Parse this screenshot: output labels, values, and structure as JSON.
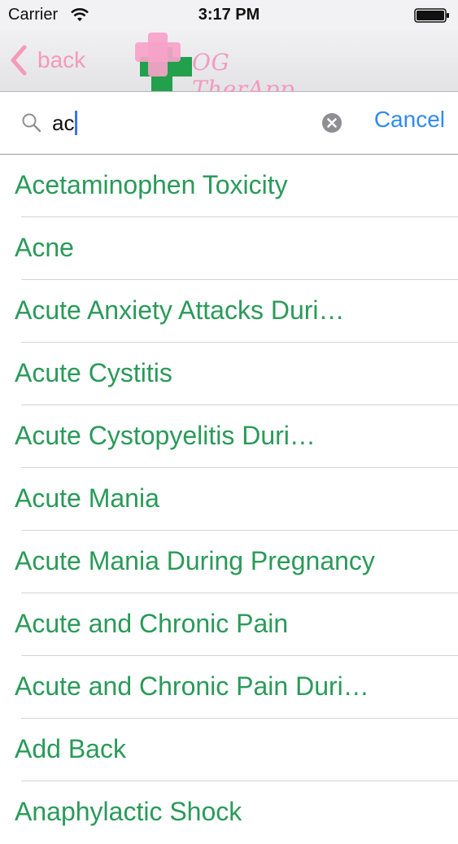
{
  "status": {
    "carrier": "Carrier",
    "time": "3:17 PM"
  },
  "nav": {
    "back_label": "back",
    "app_title": "OG TherApp"
  },
  "search": {
    "query": "ac",
    "cancel_label": "Cancel"
  },
  "results": [
    "Acetaminophen Toxicity",
    "Acne",
    "Acute Anxiety Attacks Duri…",
    "Acute Cystitis",
    "Acute Cystopyelitis Duri…",
    "Acute Mania",
    "Acute Mania During Pregnancy",
    "Acute and Chronic Pain",
    "Acute and Chronic Pain Duri…",
    "Add Back",
    "Anaphylactic Shock"
  ],
  "colors": {
    "accent_pink": "#f59ab7",
    "item_green": "#2a9a59",
    "cancel_blue": "#2f8bf0",
    "cross_green": "#22a04b"
  }
}
